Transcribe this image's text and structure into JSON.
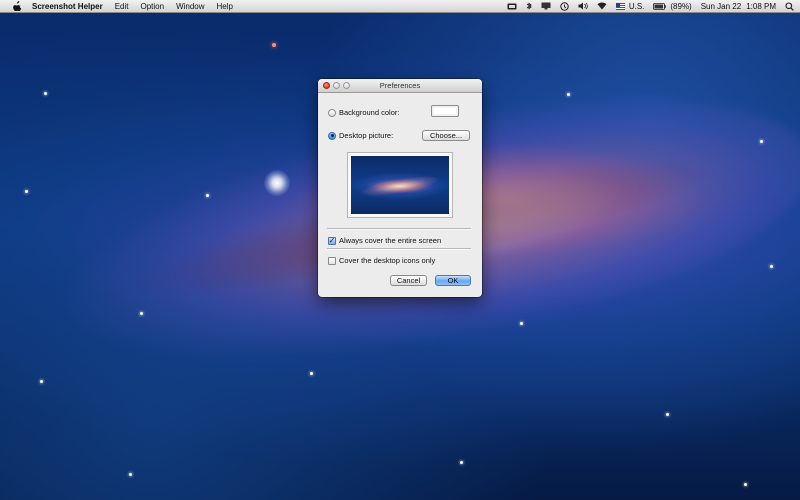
{
  "menubar": {
    "apple_icon": "apple-icon",
    "app_name": "Screenshot Helper",
    "menus": [
      "Edit",
      "Option",
      "Window",
      "Help"
    ],
    "status_icons": [
      "battery-menu-icon",
      "bluetooth-icon",
      "display-icon",
      "time-machine-icon",
      "volume-icon",
      "wifi-icon",
      "flag-us-icon",
      "battery-icon"
    ],
    "input_source": "U.S.",
    "battery_percent": "(89%)",
    "date": "Sun Jan 22",
    "time": "1:08 PM",
    "search_icon": "spotlight-search-icon"
  },
  "window": {
    "title": "Preferences",
    "background_color_label": "Background color:",
    "background_color_value": "#ffffff",
    "desktop_picture_label": "Desktop picture:",
    "choose_button": "Choose...",
    "desktop_picture_selected": true,
    "always_cover_label": "Always cover the entire screen",
    "always_cover_checked": true,
    "cover_icons_label": "Cover the desktop icons only",
    "cover_icons_checked": false,
    "cancel_button": "Cancel",
    "ok_button": "OK"
  },
  "colors": {
    "menubar": "#e6e6e6",
    "window_bg": "#ececec",
    "accent": "#6aa8ee",
    "close_button": "#e0443a",
    "wallpaper": "#0c3a84"
  }
}
